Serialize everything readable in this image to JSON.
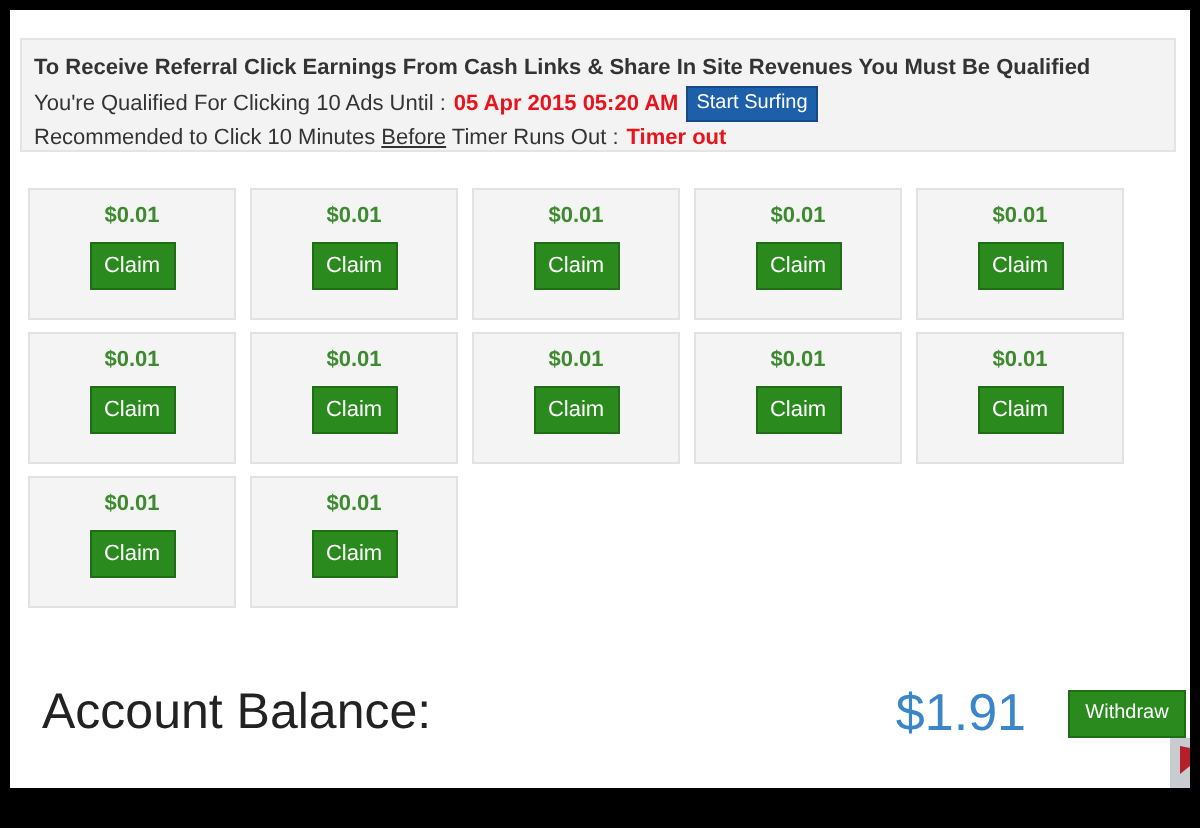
{
  "notice": {
    "heading": "To Receive Referral Click Earnings From Cash Links & Share In Site Revenues You Must Be Qualified",
    "qualified_label": "You're Qualified For Clicking 10 Ads Until :",
    "qualified_until": "05 Apr 2015 05:20 AM",
    "start_button": "Start Surfing",
    "recommend_label": "Recommended to Click 10 Minutes **Before** Timer Runs Out :",
    "timer_status": "Timer out"
  },
  "ads": [
    {
      "amount": "$0.01",
      "button": "Claim"
    },
    {
      "amount": "$0.01",
      "button": "Claim"
    },
    {
      "amount": "$0.01",
      "button": "Claim"
    },
    {
      "amount": "$0.01",
      "button": "Claim"
    },
    {
      "amount": "$0.01",
      "button": "Claim"
    },
    {
      "amount": "$0.01",
      "button": "Claim"
    },
    {
      "amount": "$0.01",
      "button": "Claim"
    },
    {
      "amount": "$0.01",
      "button": "Claim"
    },
    {
      "amount": "$0.01",
      "button": "Claim"
    },
    {
      "amount": "$0.01",
      "button": "Claim"
    },
    {
      "amount": "$0.01",
      "button": "Claim"
    },
    {
      "amount": "$0.01",
      "button": "Claim"
    }
  ],
  "balance": {
    "label": "Account Balance:",
    "amount": "$1.91",
    "button": "Withdraw"
  }
}
